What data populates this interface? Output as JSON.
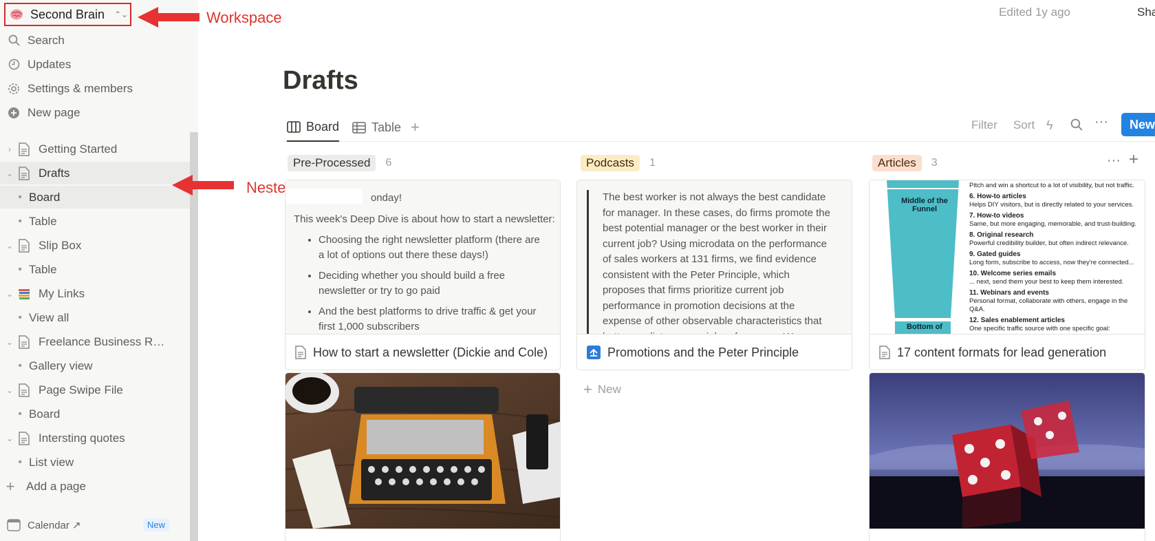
{
  "workspace": {
    "name": "Second Brain"
  },
  "sidebar": {
    "top_items": [
      {
        "label": "Search",
        "icon": "search-icon"
      },
      {
        "label": "Updates",
        "icon": "clock-icon"
      },
      {
        "label": "Settings & members",
        "icon": "gear-icon"
      },
      {
        "label": "New page",
        "icon": "plus-circle-icon"
      }
    ],
    "tree": [
      {
        "label": "Getting Started"
      },
      {
        "label": "Drafts"
      },
      {
        "label": "Board"
      },
      {
        "label": "Table"
      },
      {
        "label": "Slip Box"
      },
      {
        "label": "Table"
      },
      {
        "label": "My Links"
      },
      {
        "label": "View all"
      },
      {
        "label": "Freelance Business Res..."
      },
      {
        "label": "Gallery view"
      },
      {
        "label": "Page Swipe File"
      },
      {
        "label": "Board"
      },
      {
        "label": "Intersting quotes"
      },
      {
        "label": "List view"
      }
    ],
    "add_page": "Add a page",
    "calendar": {
      "label": "Calendar ↗",
      "badge": "New",
      "icon_day": "16"
    }
  },
  "annotations": {
    "workspace": "Workspace",
    "nested": "Nested pages"
  },
  "topbar": {
    "edited": "Edited 1y ago",
    "user": "Sha"
  },
  "page": {
    "title": "Drafts"
  },
  "views": {
    "tabs": [
      {
        "label": "Board"
      },
      {
        "label": "Table"
      }
    ],
    "add": "+",
    "filter": "Filter",
    "sort": "Sort",
    "new_button": "New"
  },
  "board": {
    "columns": [
      {
        "name": "Pre-Processed",
        "count": "6",
        "color": "#ebebea"
      },
      {
        "name": "Podcasts",
        "count": "1",
        "color": "#fbecc6"
      },
      {
        "name": "Articles",
        "count": "3",
        "color": "#fadfcf"
      }
    ],
    "cards": {
      "newsletter": {
        "greeting": "onday!",
        "intro": "This week's Deep Dive is about how to start a newsletter:",
        "bullets": [
          "Choosing the right newsletter platform (there are a lot of options out there these days!)",
          "Deciding whether you should build a free newsletter or try to go paid",
          "And the best platforms to drive traffic & get your first 1,000 subscribers"
        ],
        "title": "How to start a newsletter (Dickie and Cole)"
      },
      "peter": {
        "quote": "The best worker is not always the best candidate for manager. In these cases, do firms promote the best potential manager or the best worker in their current job? Using microdata on the performance of sales workers at 131 firms, we find evidence consistent with the Peter Principle, which proposes that firms prioritize current job performance in promotion decisions at the expense of other observable characteristics that better predict managerial performance. We",
        "title": "Promotions and the Peter Principle"
      },
      "content": {
        "funnel_mid": "Middle of the Funnel",
        "funnel_bot": "Bottom of",
        "pitch": "Pitch and win a shortcut to a lot of visibility, but not traffic.",
        "items": [
          {
            "h": "6. How-to articles",
            "t": "Helps DIY visitors, but is directly related to your services."
          },
          {
            "h": "7. How-to videos",
            "t": "Same, but more engaging, memorable, and trust-building."
          },
          {
            "h": "8. Original research",
            "t": "Powerful credibility builder, but often indirect relevance."
          },
          {
            "h": "9. Gated guides",
            "t": "Long form, subscribe to access, now they're connected..."
          },
          {
            "h": "10. Welcome series emails",
            "t": "... next, send them your best to keep them interested."
          },
          {
            "h": "11. Webinars and events",
            "t": "Personal format, collaborate with others, engage in the Q&A."
          },
          {
            "h": "12. Sales enablement articles",
            "t": "One specific traffic source with one specific goal: conversion."
          }
        ],
        "title": "17 content formats for lead generation"
      }
    },
    "add_new": "New"
  }
}
